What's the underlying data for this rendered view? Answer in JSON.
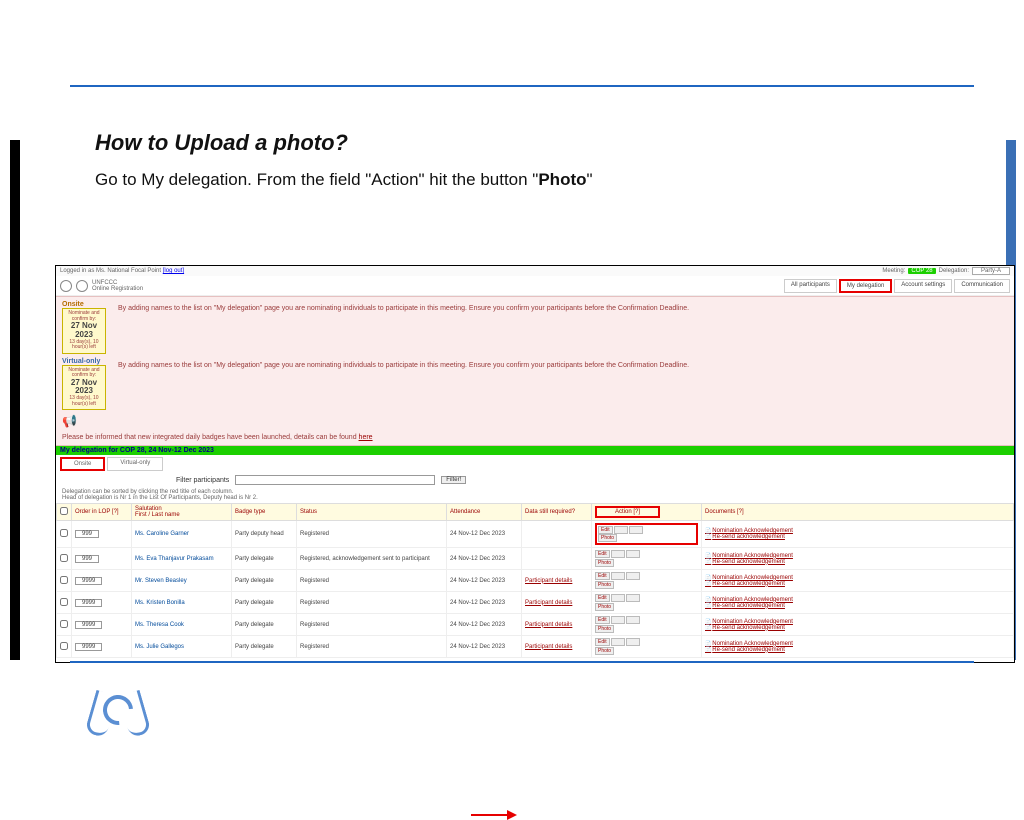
{
  "slide": {
    "title": "How to Upload a photo?",
    "body_prefix": "Go to My delegation. From the field \"Action\" hit the button \"",
    "body_bold": "Photo",
    "body_suffix": "\""
  },
  "top": {
    "logged_in": "Logged in as Ms. National Focal Point",
    "logout": "[log out]",
    "meeting_label": "Meeting:",
    "meeting_value": "COP 28",
    "delegation_label": "Delegation:",
    "delegation_value": "Party-A"
  },
  "brand": {
    "line1": "UNFCCC",
    "line2": "Online Registration"
  },
  "tabs": {
    "all": "All participants",
    "my": "My delegation",
    "acct": "Account settings",
    "comm": "Communication"
  },
  "pink": {
    "onsite_label": "Onsite",
    "onsite_sub": "Nominate and confirm by:",
    "onsite_date": "27 Nov 2023",
    "onsite_days": "13 day(s), 10 hour(s) left",
    "onsite_msg": "By adding names to the list on \"My delegation\" page you are nominating individuals to participate in this meeting. Ensure you confirm your participants before the Confirmation Deadline.",
    "virtual_label": "Virtual-only",
    "virtual_sub": "Nominate and confirm by:",
    "virtual_date": "27 Nov 2023",
    "virtual_days": "13 day(s), 10 hour(s) left",
    "virtual_msg": "By adding names to the list on \"My delegation\" page you are nominating individuals to participate in this meeting. Ensure you confirm your participants before the Confirmation Deadline.",
    "notice": "Please be informed that new integrated daily badges have been launched, details can be found ",
    "notice_link": "here"
  },
  "greenbar": "My delegation for COP 28, 24 Nov-12 Dec 2023",
  "subtabs": {
    "onsite": "Onsite",
    "virtual": "Virtual-only"
  },
  "filter": {
    "label": "Filter participants",
    "button": "Filter!"
  },
  "note": "Delegation can be sorted by clicking the red title of each column.\nHead of delegation is Nr 1 in the List Of Participants, Deputy head is Nr 2.",
  "columns": {
    "order": "Order in LOP [?]",
    "salutation": "Salutation\nFirst / Last name",
    "badge": "Badge type",
    "status": "Status",
    "attendance": "Attendance",
    "data": "Data still required?",
    "action": "Action [?]",
    "documents": "Documents [?]"
  },
  "actions": {
    "edit": "Edit",
    "photo": "Photo"
  },
  "docs": {
    "nom": "Nomination Acknowledgement",
    "resend": "Re-send acknowledgement"
  },
  "rows": [
    {
      "order": "999",
      "name": "Ms. Caroline Garner",
      "badge": "Party deputy head",
      "status": "Registered",
      "attendance": "24 Nov-12 Dec 2023",
      "data": ""
    },
    {
      "order": "999",
      "name": "Ms. Eva Thanjavur Prakasam",
      "badge": "Party delegate",
      "status": "Registered, acknowledgement sent to participant",
      "attendance": "24 Nov-12 Dec 2023",
      "data": ""
    },
    {
      "order": "9999",
      "name": "Mr. Steven Beasley",
      "badge": "Party delegate",
      "status": "Registered",
      "attendance": "24 Nov-12 Dec 2023",
      "data": "Participant details"
    },
    {
      "order": "9999",
      "name": "Ms. Kristen Bonilla",
      "badge": "Party delegate",
      "status": "Registered",
      "attendance": "24 Nov-12 Dec 2023",
      "data": "Participant details"
    },
    {
      "order": "9999",
      "name": "Ms. Theresa Cook",
      "badge": "Party delegate",
      "status": "Registered",
      "attendance": "24 Nov-12 Dec 2023",
      "data": "Participant details"
    },
    {
      "order": "9999",
      "name": "Ms. Julie Gallegos",
      "badge": "Party delegate",
      "status": "Registered",
      "attendance": "24 Nov-12 Dec 2023",
      "data": "Participant details"
    }
  ]
}
